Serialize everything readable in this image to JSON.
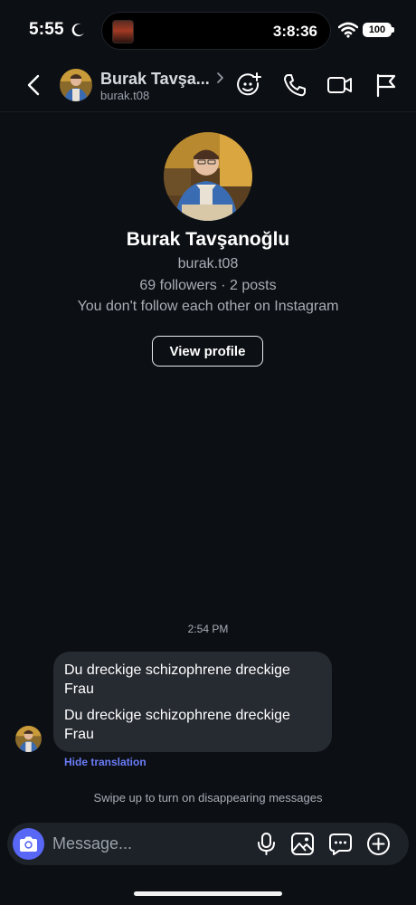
{
  "status_bar": {
    "time": "5:55",
    "island_timer": "3:8:36",
    "battery_level": "100"
  },
  "header": {
    "name": "Burak Tavşa...",
    "username": "burak.t08"
  },
  "profile": {
    "name": "Burak Tavşanoğlu",
    "username": "burak.t08",
    "stats": "69 followers · 2 posts",
    "follow_status": "You don't follow each other on Instagram",
    "view_profile_label": "View profile"
  },
  "conversation": {
    "timestamp": "2:54 PM",
    "message": {
      "original": "Du dreckige schizophrene dreckige Frau",
      "translated": "Du dreckige schizophrene dreckige Frau"
    },
    "hide_translation_label": "Hide translation",
    "disappearing_hint": "Swipe up to turn on disappearing messages"
  },
  "composer": {
    "placeholder": "Message..."
  },
  "icons": {
    "status": [
      "moon-icon",
      "wifi-icon"
    ],
    "header": [
      "back-icon",
      "chevron-right-icon",
      "add-sticker-icon",
      "phone-icon",
      "video-camera-icon",
      "flag-icon"
    ],
    "composer": [
      "camera-icon",
      "microphone-icon",
      "image-icon",
      "sticker-chat-icon",
      "plus-circle-icon"
    ]
  },
  "colors": {
    "background": "#0c0f14",
    "bubble": "#262a31",
    "accent": "#5867f5",
    "link": "#6a7cf7",
    "muted_text": "#a8aeb6"
  }
}
